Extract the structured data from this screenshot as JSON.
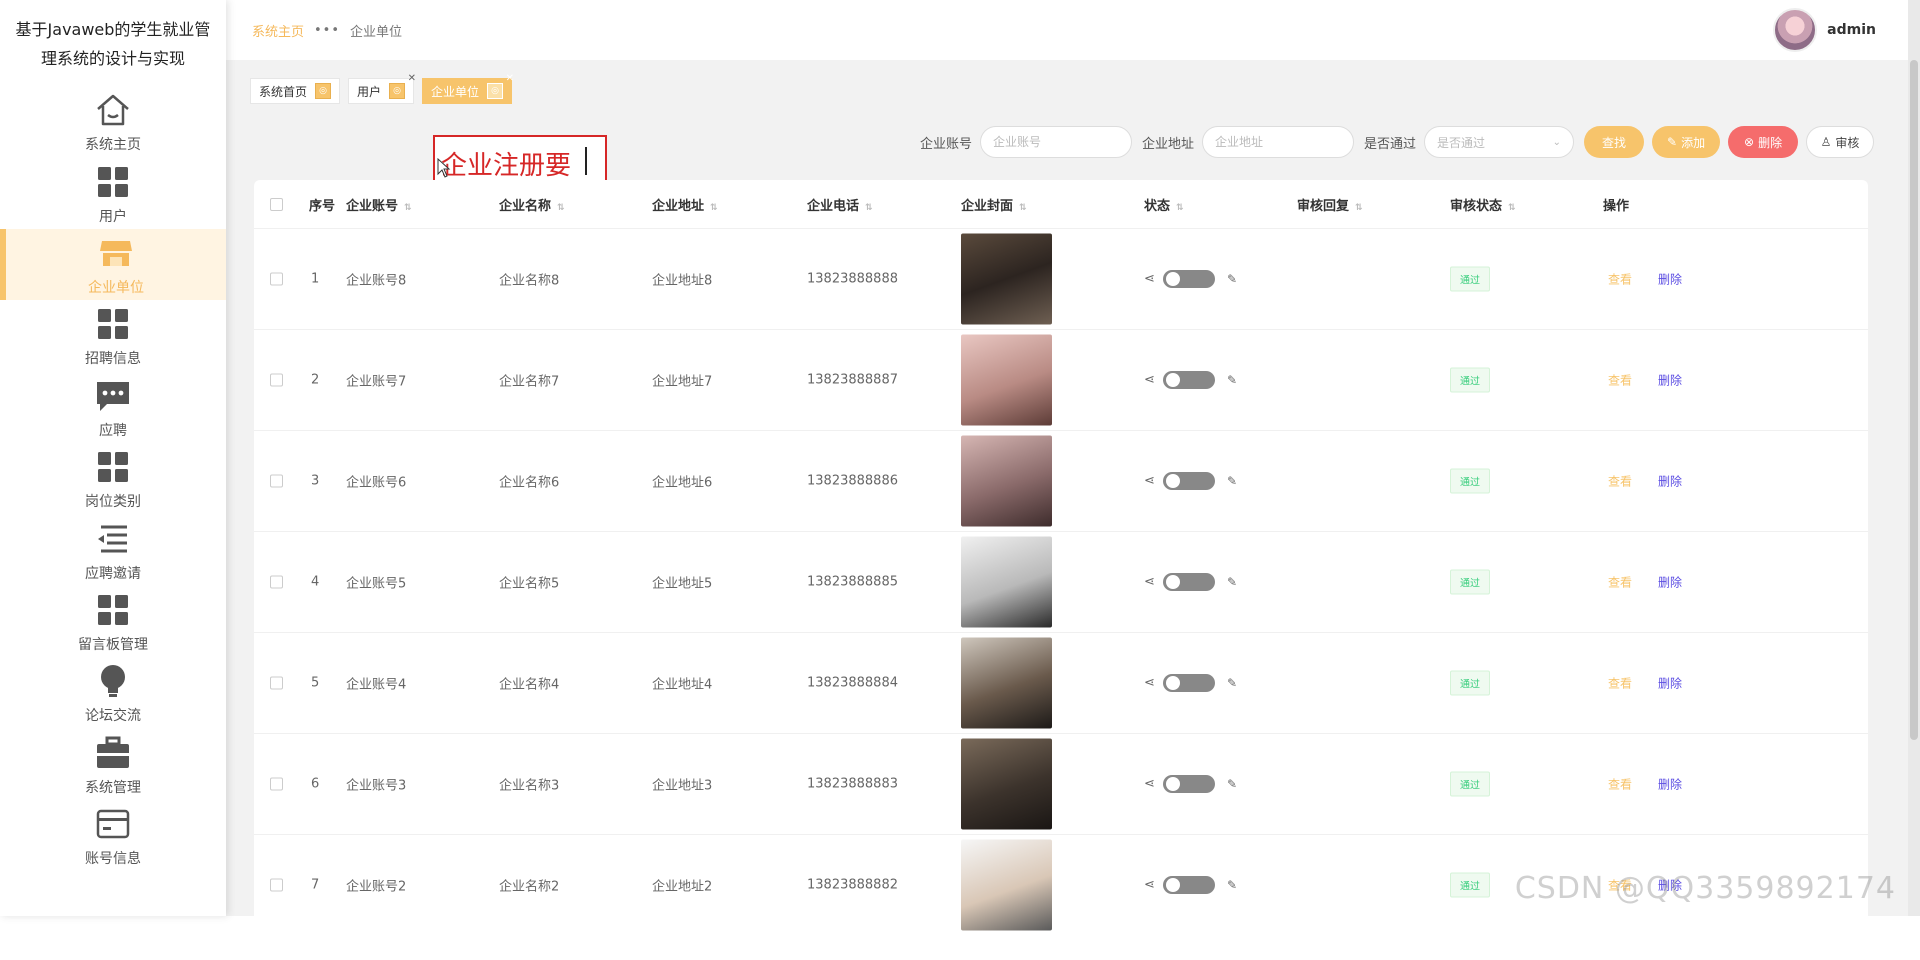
{
  "app": {
    "title": "基于Javaweb的学生就业管理系统的设计与实现"
  },
  "sidebar": {
    "items": [
      {
        "label": "系统主页",
        "icon": "home-icon"
      },
      {
        "label": "用户",
        "icon": "grid-icon"
      },
      {
        "label": "企业单位",
        "icon": "shop-icon"
      },
      {
        "label": "招聘信息",
        "icon": "grid-icon"
      },
      {
        "label": "应聘",
        "icon": "chat-icon"
      },
      {
        "label": "岗位类别",
        "icon": "grid-icon"
      },
      {
        "label": "应聘邀请",
        "icon": "list-icon"
      },
      {
        "label": "留言板管理",
        "icon": "grid-icon"
      },
      {
        "label": "论坛交流",
        "icon": "bulb-icon"
      },
      {
        "label": "系统管理",
        "icon": "briefcase-icon"
      },
      {
        "label": "账号信息",
        "icon": "card-icon"
      }
    ]
  },
  "breadcrumb": {
    "home": "系统主页",
    "current": "企业单位"
  },
  "user": {
    "name": "admin"
  },
  "tags": [
    {
      "label": "系统首页",
      "closable": false,
      "active": false
    },
    {
      "label": "用户",
      "closable": true,
      "active": false
    },
    {
      "label": "企业单位",
      "closable": true,
      "active": true
    }
  ],
  "annotation": {
    "text": "企业注册要"
  },
  "search": {
    "account_label": "企业账号",
    "account_placeholder": "企业账号",
    "address_label": "企业地址",
    "address_placeholder": "企业地址",
    "pass_label": "是否通过",
    "pass_placeholder": "是否通过",
    "btn_search": "查找",
    "btn_add": "添加",
    "btn_delete": "删除",
    "btn_audit": "审核"
  },
  "table": {
    "headers": [
      "序号",
      "企业账号",
      "企业名称",
      "企业地址",
      "企业电话",
      "企业封面",
      "状态",
      "审核回复",
      "审核状态",
      "操作"
    ],
    "rows": [
      {
        "index": "1",
        "account": "企业账号8",
        "name": "企业名称8",
        "address": "企业地址8",
        "phone": "13823888888",
        "audit": "通过"
      },
      {
        "index": "2",
        "account": "企业账号7",
        "name": "企业名称7",
        "address": "企业地址7",
        "phone": "13823888887",
        "audit": "通过"
      },
      {
        "index": "3",
        "account": "企业账号6",
        "name": "企业名称6",
        "address": "企业地址6",
        "phone": "13823888886",
        "audit": "通过"
      },
      {
        "index": "4",
        "account": "企业账号5",
        "name": "企业名称5",
        "address": "企业地址5",
        "phone": "13823888885",
        "audit": "通过"
      },
      {
        "index": "5",
        "account": "企业账号4",
        "name": "企业名称4",
        "address": "企业地址4",
        "phone": "13823888884",
        "audit": "通过"
      },
      {
        "index": "6",
        "account": "企业账号3",
        "name": "企业名称3",
        "address": "企业地址3",
        "phone": "13823888883",
        "audit": "通过"
      },
      {
        "index": "7",
        "account": "企业账号2",
        "name": "企业名称2",
        "address": "企业地址2",
        "phone": "13823888882",
        "audit": "通过"
      }
    ],
    "action_view": "查看",
    "action_delete": "删除"
  },
  "watermark": "CSDN @QQ3359892174",
  "colors": {
    "accent": "#f7c46b",
    "danger": "#f56c6c",
    "link_delete": "#5b4de2",
    "success": "#3ccf7f"
  }
}
